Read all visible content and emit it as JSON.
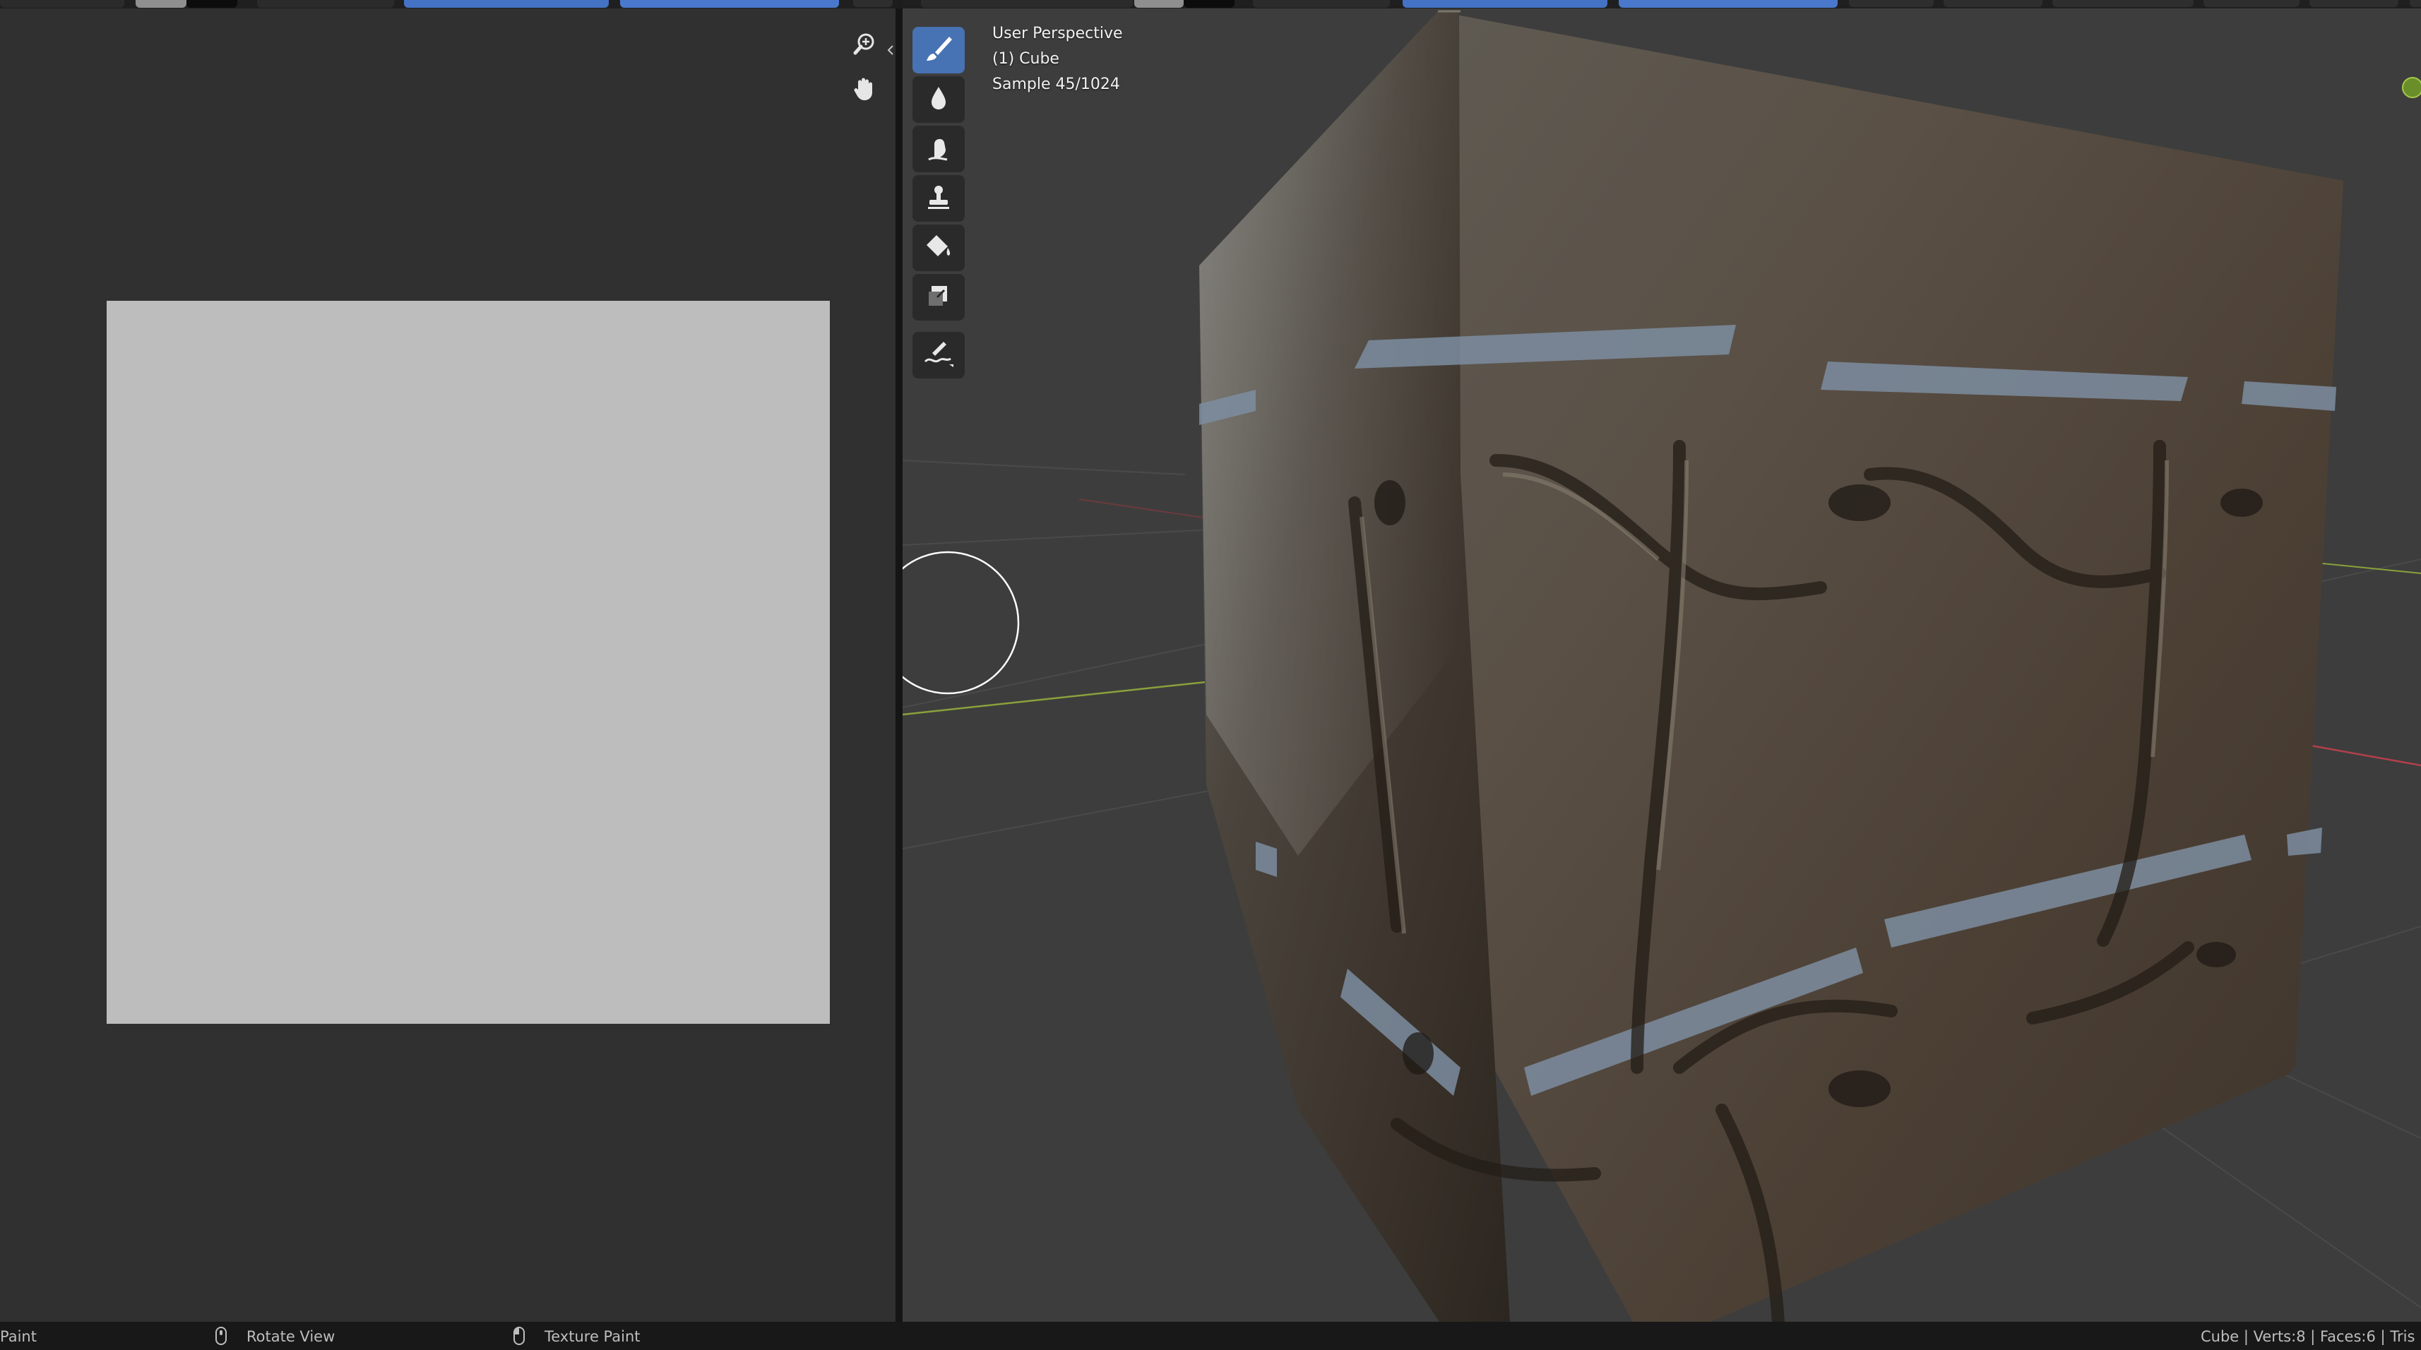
{
  "image_editor": {
    "icons": [
      "zoom-icon",
      "hand-pan-icon",
      "collapse-arrow-icon"
    ]
  },
  "viewport": {
    "overlay": {
      "view_name": "User Perspective",
      "object_name": "(1) Cube",
      "render_sample": "Sample 45/1024"
    },
    "toolbar": {
      "tools": [
        {
          "name": "draw",
          "icon": "brush-icon",
          "active": true
        },
        {
          "name": "soften",
          "icon": "drop-icon",
          "active": false
        },
        {
          "name": "smear",
          "icon": "finger-icon",
          "active": false
        },
        {
          "name": "clone",
          "icon": "stamp-icon",
          "active": false
        },
        {
          "name": "fill",
          "icon": "bucket-icon",
          "active": false
        },
        {
          "name": "mask",
          "icon": "mask-icon",
          "active": false
        },
        {
          "name": "annotate",
          "icon": "annotate-pen-icon",
          "active": false
        }
      ]
    },
    "colors": {
      "background": "#3d3d3d",
      "x_axis": "#b3404a",
      "y_axis": "#8aa13b",
      "active_tool": "#4772b3"
    }
  },
  "statusbar": {
    "mode": "Paint",
    "rotate_hint": "Rotate View",
    "paint_hint": "Texture Paint",
    "stats": "Cube | Verts:8 | Faces:6 | Tris"
  }
}
